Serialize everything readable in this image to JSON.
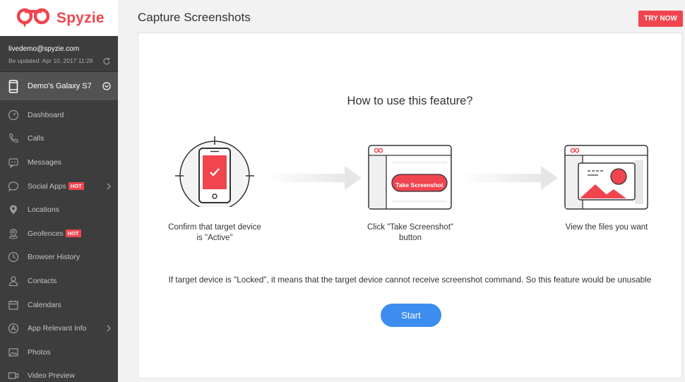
{
  "app": {
    "brand": "Spyzie",
    "accent": "#f0454f"
  },
  "account": {
    "email": "livedemo@spyzie.com",
    "updated": "Be updated: Apr 10, 2017 11:28"
  },
  "device": {
    "name": "Demo's Galaxy S7"
  },
  "nav": [
    {
      "label": "Dashboard",
      "icon": "dashboard-icon"
    },
    {
      "label": "Calls",
      "icon": "phone-icon"
    },
    {
      "label": "Messages",
      "icon": "message-icon"
    },
    {
      "label": "Social Apps",
      "icon": "chat-bubble-icon",
      "badge": "HOT",
      "has_arrow": true
    },
    {
      "label": "Locations",
      "icon": "location-pin-icon"
    },
    {
      "label": "Geofences",
      "icon": "geofence-icon",
      "badge": "HOT"
    },
    {
      "label": "Browser History",
      "icon": "clock-icon"
    },
    {
      "label": "Contacts",
      "icon": "contact-icon"
    },
    {
      "label": "Calendars",
      "icon": "calendar-icon"
    },
    {
      "label": "App Relevant Info",
      "icon": "app-store-icon",
      "has_arrow": true
    },
    {
      "label": "Photos",
      "icon": "photo-icon"
    },
    {
      "label": "Video Preview",
      "icon": "video-icon"
    }
  ],
  "header": {
    "title": "Capture Screenshots",
    "try_now": "TRY NOW"
  },
  "content": {
    "heading": "How to use this feature?",
    "steps": [
      {
        "line1": "Confirm that target device",
        "line2": "is \"Active\""
      },
      {
        "line1": "Click \"Take Screenshot\"",
        "line2": "button",
        "button_label": "Take Screenshot"
      },
      {
        "line1": "View the files you want",
        "line2": ""
      }
    ],
    "warning": "If target device is \"Locked\", it means that the target device cannot receive screenshot command. So this feature would be unusable",
    "start_label": "Start"
  }
}
